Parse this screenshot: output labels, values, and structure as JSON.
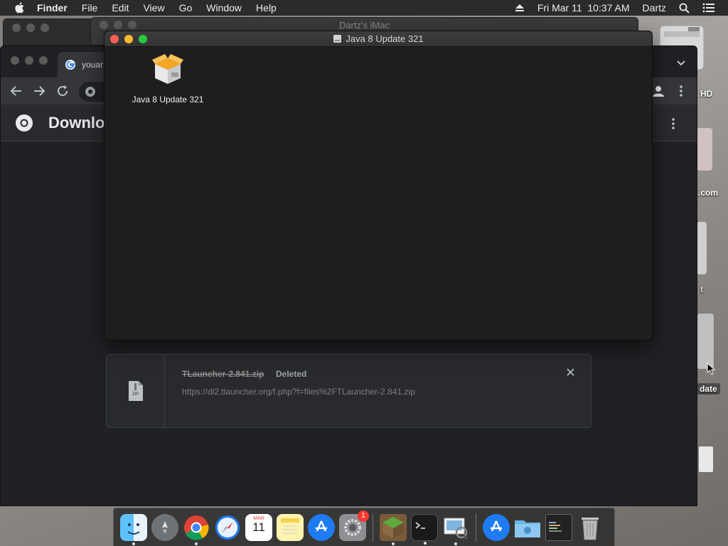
{
  "menubar": {
    "app_name": "Finder",
    "menus": [
      "File",
      "Edit",
      "View",
      "Go",
      "Window",
      "Help"
    ],
    "datetime": "Fri Mar 11  10:37 AM",
    "user": "Dartz"
  },
  "desktop": {
    "labels": [
      "HD",
      ".com",
      "t",
      "date"
    ]
  },
  "background_finder": {
    "title": "Dartz's iMac"
  },
  "chrome": {
    "tab_title": "youar",
    "page_title": "Downloa",
    "download": {
      "filename": "TLauncher-2.841.zip",
      "status": "Deleted",
      "url": "https://dl2.tlauncher.org/f.php?f=files%2FTLauncher-2.841.zip",
      "file_type": "ZIP"
    }
  },
  "finder_window": {
    "title": "Java 8 Update 321",
    "item_label": "Java 8 Update 321"
  },
  "dock": {
    "apps": [
      "finder",
      "launchpad",
      "chrome",
      "safari",
      "calendar",
      "notes",
      "app-store",
      "system-preferences",
      "minecraft",
      "terminal",
      "preview",
      "app-store-download",
      "folder",
      "screenshot",
      "trash"
    ],
    "calendar_month": "MAR",
    "calendar_day": "11",
    "system_prefs_badge": "1",
    "colors": {
      "accent": "#1f7bf2",
      "badge": "#f23a2f"
    }
  }
}
